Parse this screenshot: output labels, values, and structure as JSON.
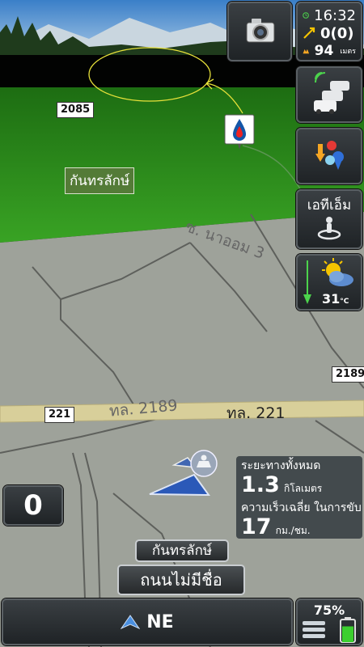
{
  "status": {
    "time": "16:32",
    "alert_count": "0(0)",
    "distance": "94",
    "distance_unit": "เมตร",
    "colors": {
      "clock": "#4cd34c",
      "alert": "#f5c400",
      "distance": "#f5a623"
    }
  },
  "toolbar": {
    "camera_icon": "camera-icon",
    "traffic_icon": "traffic-cars-icon",
    "poi_icon": "poi-pins-icon",
    "atm_label": "เอทีเอ็ม",
    "atm_icon": "person-pin-icon",
    "weather_icon": "partly-cloudy-icon",
    "temperature": "31",
    "temperature_unit": "°C"
  },
  "map": {
    "road_shields": [
      "2085",
      "2189",
      "221"
    ],
    "area_label": "กันทรลักษ์",
    "road_label_221": "ทล. 221",
    "road_label_2189": "ทล. 2189",
    "soi_label": "ซ. นาออม 3",
    "colors": {
      "grass": "#2e8b1e",
      "ground": "#9ea29a",
      "road": "#d8cf9a",
      "sky": "#000000"
    }
  },
  "speed": {
    "value": "0"
  },
  "trip": {
    "total_distance_label": "ระยะทางทั้งหมด",
    "total_distance_value": "1.3",
    "total_distance_unit": "กิโลเมตร",
    "avg_speed_label": "ความเร็วเฉลี่ย ในการขับ",
    "avg_speed_value": "17",
    "avg_speed_unit": "กม./ชม."
  },
  "street": {
    "area_name": "กันทรลักษ์",
    "street_name": "ถนนไม่มีชื่อ"
  },
  "navigation": {
    "heading": "NE"
  },
  "battery": {
    "percent": "75%",
    "level": 0.75
  }
}
